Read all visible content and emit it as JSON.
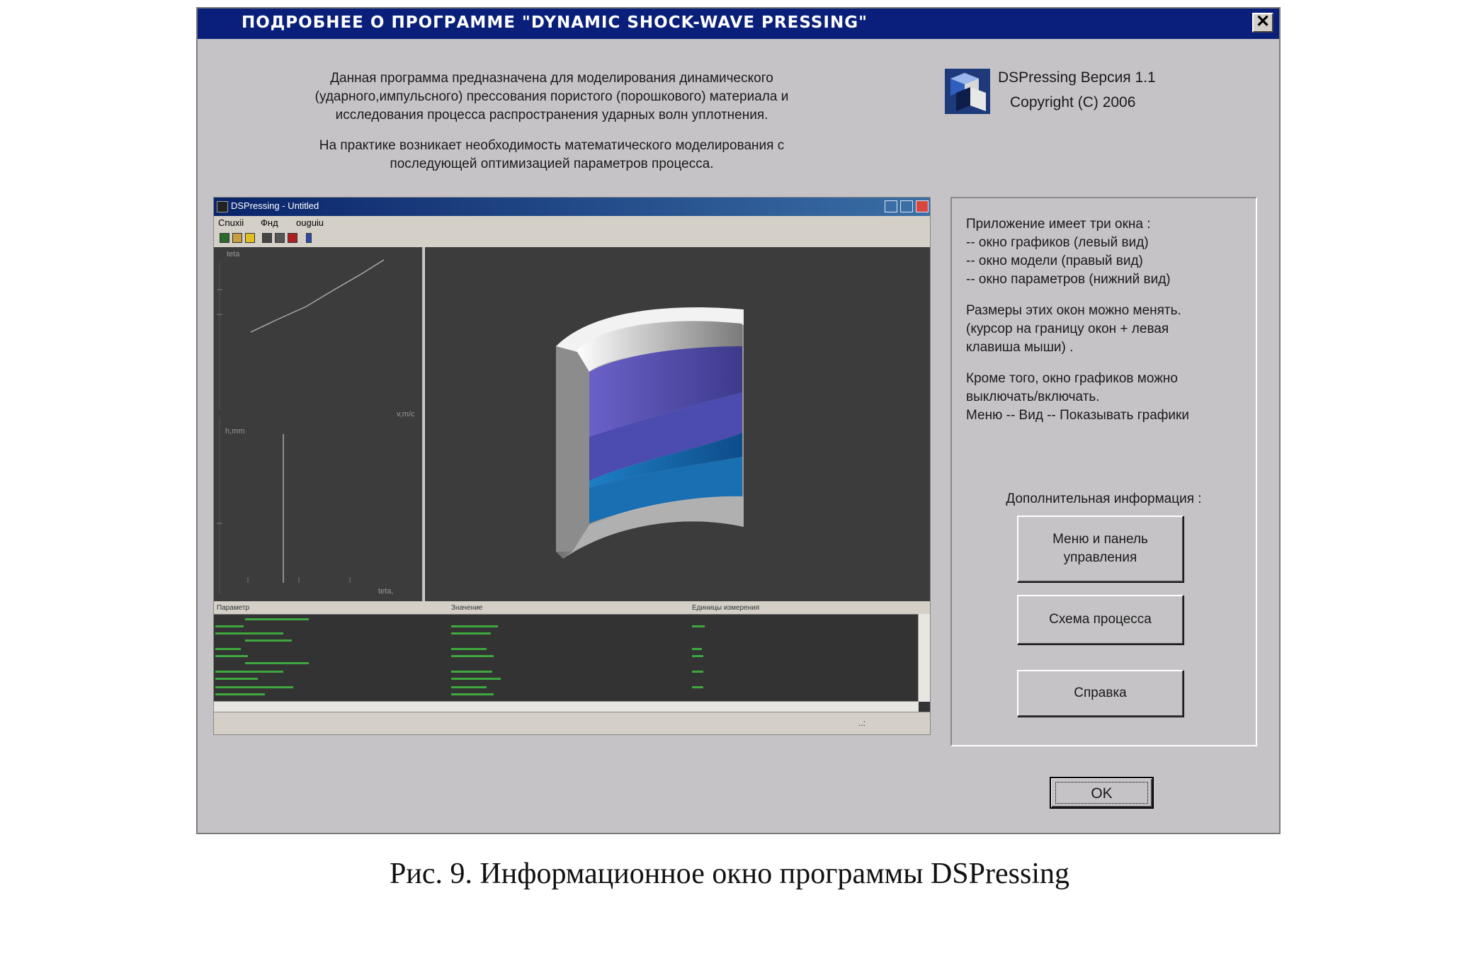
{
  "dialog": {
    "title": "ПОДРОБНЕЕ О ПРОГРАММЕ \"DYNAMIC SHOCK-WAVE PRESSING\"",
    "close_label": "✕",
    "description": [
      "Данная программа предназначена для моделирования динамического",
      "(ударного,импульсного) прессования пористого (порошкового) материала и",
      "исследования процесса распространения ударных волн уплотнения.",
      "На практике возникает необходимость математического моделирования с",
      "последующей оптимизацией параметров процесса."
    ],
    "version": "DSPressing Версия 1.1",
    "copyright": "Copyright (C) 2006",
    "info": [
      "Приложение имеет три окна :",
      "--  окно графиков (левый вид)",
      "--  окно модели (правый вид)",
      "--  окно параметров (нижний вид)",
      "Размеры этих окон можно менять.",
      "(курсор на границу окон + левая",
      "клавиша мыши) .",
      "Кроме того, окно графиков можно",
      "выключать/включать.",
      "Меню -- Вид -- Показывать графики"
    ],
    "additional_label": "Дополнительная информация :",
    "buttons": {
      "menu_line1": "Меню и панель",
      "menu_line2": "управления",
      "scheme": "Схема процесса",
      "help": "Справка",
      "ok": "OK"
    },
    "accent_color": "#0a1f7a"
  },
  "screenshot": {
    "title": "DSPressing - Untitled",
    "menu": [
      "Cnuxii",
      "Фнд",
      "ouguiu"
    ],
    "graph_labels": {
      "teta_top": "teta",
      "velocity": "v,m/c",
      "h": "h,mm",
      "teta_bottom": "teta,"
    },
    "table_headers": [
      "Параметр",
      "Значение",
      "Единицы измерения"
    ],
    "status_text": "..:"
  },
  "caption": "Рис. 9. Информационное окно программы DSPressing"
}
